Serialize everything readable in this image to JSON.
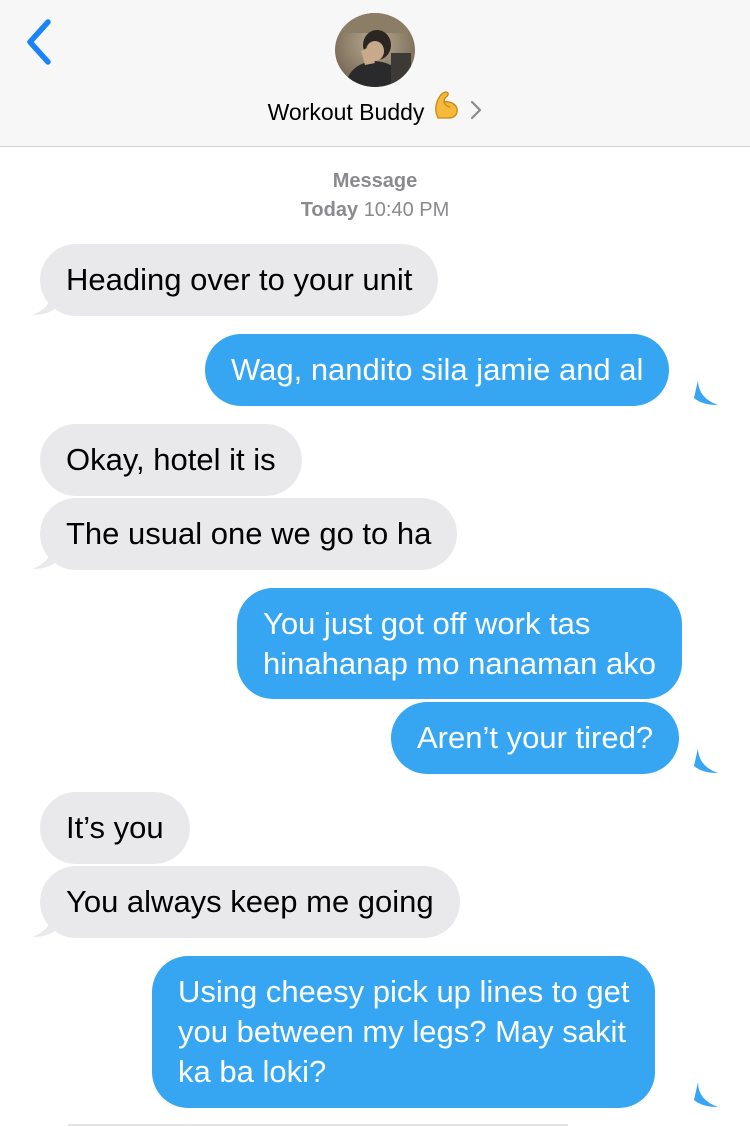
{
  "header": {
    "back_icon": "chevron-left-icon",
    "contact_name": "Workout Buddy",
    "contact_emoji": "flexed-biceps-icon",
    "chevron_icon": "chevron-right-icon",
    "avatar_icon": "contact-photo"
  },
  "thread": {
    "service_label": "Message",
    "date_label": "Today",
    "time_label": "10:40 PM"
  },
  "messages": [
    {
      "from": "them",
      "text": "Heading over to your unit"
    },
    {
      "from": "me",
      "text": "Wag, nandito sila jamie and al"
    },
    {
      "from": "them",
      "text": "Okay, hotel it is"
    },
    {
      "from": "them",
      "text": "The usual one we go to ha"
    },
    {
      "from": "me",
      "lines": [
        "You just got off work tas",
        "hinahanap mo nanaman ako"
      ]
    },
    {
      "from": "me",
      "text": "Aren’t your tired?"
    },
    {
      "from": "them",
      "text": "It’s you"
    },
    {
      "from": "them",
      "text": "You always keep me going"
    },
    {
      "from": "me",
      "lines": [
        "Using cheesy pick up lines to get",
        "you between my legs? May sakit",
        "ka ba loki?"
      ]
    }
  ],
  "colors": {
    "incoming_bubble": "#e9e9eb",
    "outgoing_bubble": "#36a6f3",
    "accent_blue": "#1a82fb",
    "meta_gray": "#8a8a8e"
  }
}
